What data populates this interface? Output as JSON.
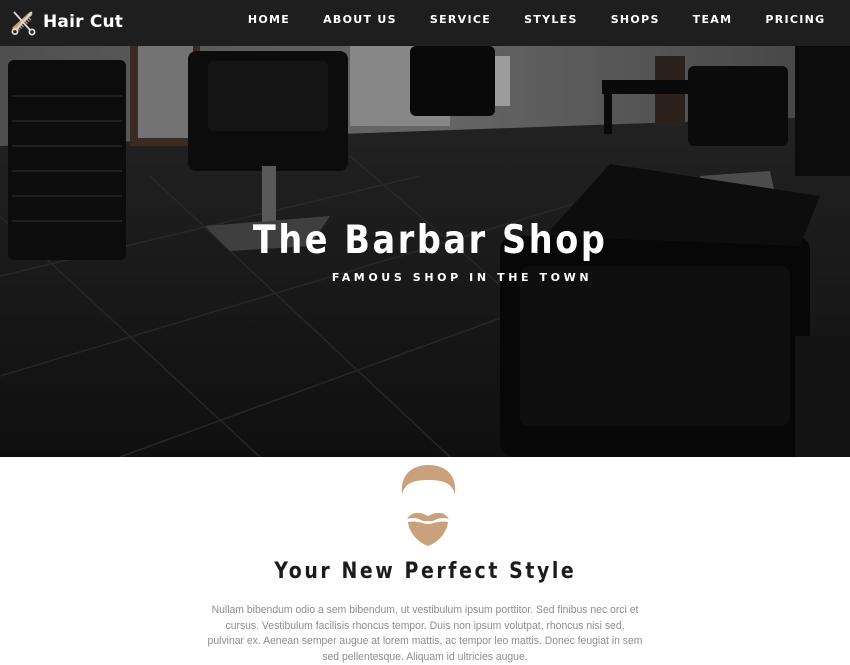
{
  "brand": {
    "name": "Hair Cut",
    "logo_icon": "scissors-comb-icon"
  },
  "nav": {
    "items": [
      {
        "label": "HOME"
      },
      {
        "label": "ABOUT US"
      },
      {
        "label": "SERVICE"
      },
      {
        "label": "STYLES"
      },
      {
        "label": "SHOPS"
      },
      {
        "label": "TEAM"
      },
      {
        "label": "PRICING"
      }
    ]
  },
  "hero": {
    "title": "The Barbar Shop",
    "subtitle": "FAMOUS SHOP IN THE TOWN"
  },
  "intro": {
    "icon": "beard-mustache-face-icon",
    "title": "Your New Perfect Style",
    "text": "Nullam bibendum odio a sem bibendum, ut vestibulum ipsum porttitor. Sed finibus nec orci et cursus. Vestibulum facilisis rhoncus tempor. Duis non ipsum volutpat, rhoncus nisi sed, pulvinar ex. Aenean semper augue at lorem mattis, ac tempor leo mattis. Donec feugiat in sem sed pellentesque. Aliquam id ultricies augue."
  },
  "colors": {
    "navbar_bg": "#1e1e1e",
    "accent_tan": "#c9a17a",
    "text_dark": "#1c1c1c",
    "text_muted": "#8d8d8d"
  }
}
